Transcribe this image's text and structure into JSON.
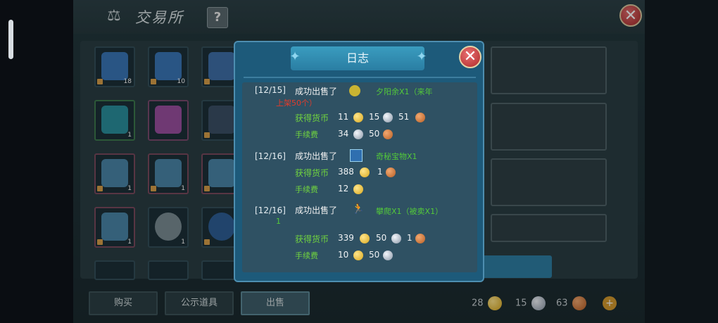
{
  "window": {
    "title": "交易所",
    "help_label": "?",
    "close_label": "✕"
  },
  "grid_items": [
    {
      "count": "18"
    },
    {
      "count": "10"
    },
    {
      "count": ""
    },
    {
      "count": "1"
    },
    {
      "count": ""
    },
    {
      "count": ""
    },
    {
      "count": "1"
    },
    {
      "count": "1"
    },
    {
      "count": "1"
    },
    {
      "count": "1"
    },
    {
      "count": "1"
    },
    {
      "count": ""
    }
  ],
  "tabs": {
    "buy": "购买",
    "public": "公示道具",
    "sell": "出售"
  },
  "currency": {
    "gold": "28",
    "silver": "15",
    "copper": "63",
    "add_label": "+"
  },
  "dialog": {
    "title": "日志",
    "close_label": "✕",
    "entries": [
      {
        "date": "[12/15]",
        "action": "成功出售了",
        "item_name": "夕阳余X1（来年",
        "item_note": "上架50个）",
        "earned_label": "获得货币",
        "earned": {
          "gold": "11",
          "silver": "15",
          "copper": "51"
        },
        "fee_label": "手续费",
        "fee": {
          "silver": "34",
          "copper": "50"
        }
      },
      {
        "date": "[12/16]",
        "action": "成功出售了",
        "item_name": "奇秘宝物X1",
        "earned_label": "获得货币",
        "earned": {
          "gold": "388",
          "copper": "1"
        },
        "fee_label": "手续费",
        "fee": {
          "gold": "12"
        }
      },
      {
        "date": "[12/16]",
        "action": "成功出售了",
        "item_name": "攀爬X1（被卖X1）",
        "item_name_cont": "1",
        "earned_label": "获得货币",
        "earned": {
          "gold": "339",
          "silver": "50",
          "copper": "1"
        },
        "fee_label": "手续费",
        "fee": {
          "gold": "10",
          "silver": "50"
        }
      }
    ]
  },
  "colors": {
    "accent": "#2a7ea3",
    "gold": "#f2c53a",
    "silver": "#c6ced8",
    "copper": "#d1783a",
    "green_text": "#71d43f"
  }
}
